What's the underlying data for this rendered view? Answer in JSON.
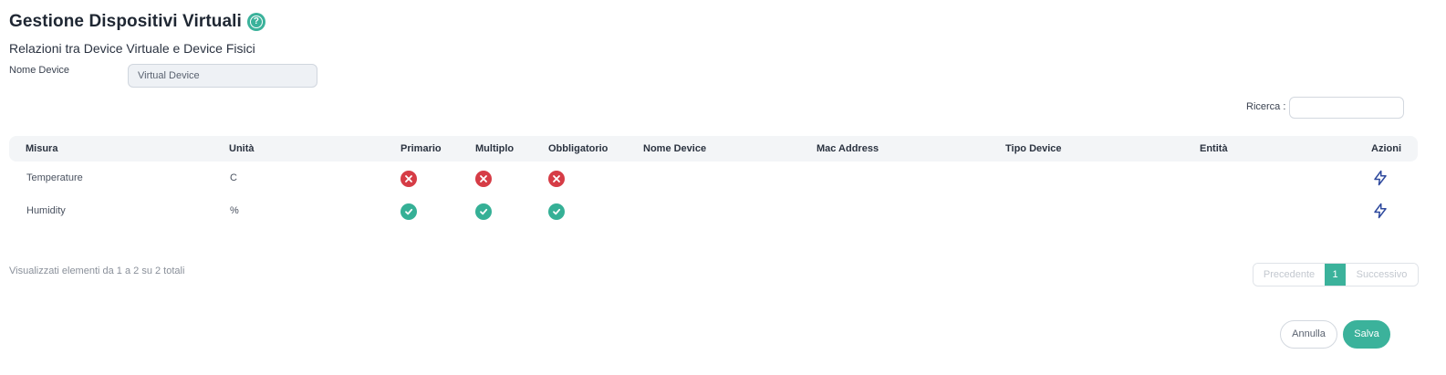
{
  "page": {
    "title": "Gestione Dispositivi Virtuali",
    "help_icon": "question-circle-icon",
    "subtitle": "Relazioni tra Device Virtuale e Device Fisici"
  },
  "form": {
    "device_name_label": "Nome Device",
    "device_name_value": "Virtual Device"
  },
  "search": {
    "label": "Ricerca :",
    "value": ""
  },
  "table": {
    "columns": [
      "Misura",
      "Unità",
      "Primario",
      "Multiplo",
      "Obbligatorio",
      "Nome Device",
      "Mac Address",
      "Tipo Device",
      "Entità",
      "Azioni"
    ],
    "rows": [
      {
        "misura": "Temperature",
        "unita": "C",
        "primario": "no",
        "multiplo": "no",
        "obbligatorio": "no",
        "nome_device": "",
        "mac_address": "",
        "tipo_device": "",
        "entita": "",
        "action_icon": "lightning-icon"
      },
      {
        "misura": "Humidity",
        "unita": "%",
        "primario": "yes",
        "multiplo": "yes",
        "obbligatorio": "yes",
        "nome_device": "",
        "mac_address": "",
        "tipo_device": "",
        "entita": "",
        "action_icon": "lightning-icon"
      }
    ]
  },
  "pagination": {
    "info": "Visualizzati elementi da 1 a 2 su 2 totali",
    "prev_label": "Precedente",
    "current_page": "1",
    "next_label": "Successivo"
  },
  "footer": {
    "cancel_label": "Annulla",
    "save_label": "Salva"
  },
  "colors": {
    "accent": "#3bb29b",
    "error": "#d63c46",
    "action_icon": "#2f4a9e"
  }
}
